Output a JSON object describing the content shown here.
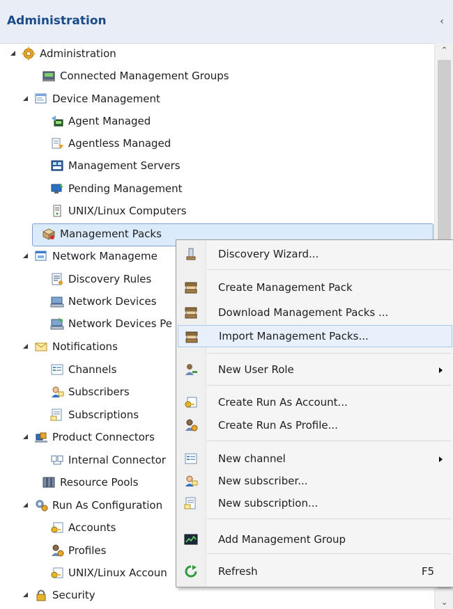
{
  "header": {
    "title": "Administration",
    "collapse_glyph": "‹"
  },
  "scrollbar": {
    "up": "⌃",
    "down": "⌄"
  },
  "tree": {
    "administration": "Administration",
    "connected_groups": "Connected Management Groups",
    "device_management": "Device Management",
    "agent_managed": "Agent Managed",
    "agentless_managed": "Agentless Managed",
    "management_servers": "Management Servers",
    "pending_management": "Pending Management",
    "unix_linux_computers": "UNIX/Linux Computers",
    "management_packs": "Management Packs",
    "network_management": "Network Manageme",
    "discovery_rules": "Discovery Rules",
    "network_devices": "Network Devices",
    "network_devices_pending": "Network Devices Pe",
    "notifications": "Notifications",
    "channels": "Channels",
    "subscribers": "Subscribers",
    "subscriptions": "Subscriptions",
    "product_connectors": "Product Connectors",
    "internal_connectors": "Internal Connector",
    "resource_pools": "Resource Pools",
    "run_as_configuration": "Run As Configuration",
    "accounts": "Accounts",
    "profiles": "Profiles",
    "unix_linux_accounts": "UNIX/Linux Accoun",
    "security": "Security"
  },
  "context_menu": {
    "discovery_wizard": "Discovery Wizard...",
    "create_management_pack": "Create Management Pack",
    "download_management_packs": "Download Management Packs ...",
    "import_management_packs": "Import Management Packs...",
    "new_user_role": "New User Role",
    "create_run_as_account": "Create Run As Account...",
    "create_run_as_profile": "Create Run As Profile...",
    "new_channel": "New channel",
    "new_subscriber": "New subscriber...",
    "new_subscription": "New subscription...",
    "add_management_group": "Add Management Group",
    "refresh": "Refresh",
    "refresh_shortcut": "F5"
  },
  "icons": {
    "gear": "gear-icon",
    "server": "server-icon",
    "folder": "folder-icon",
    "package": "package-icon",
    "envelope": "envelope-icon",
    "lock": "lock-icon",
    "person": "person-icon",
    "refresh": "refresh-icon"
  }
}
